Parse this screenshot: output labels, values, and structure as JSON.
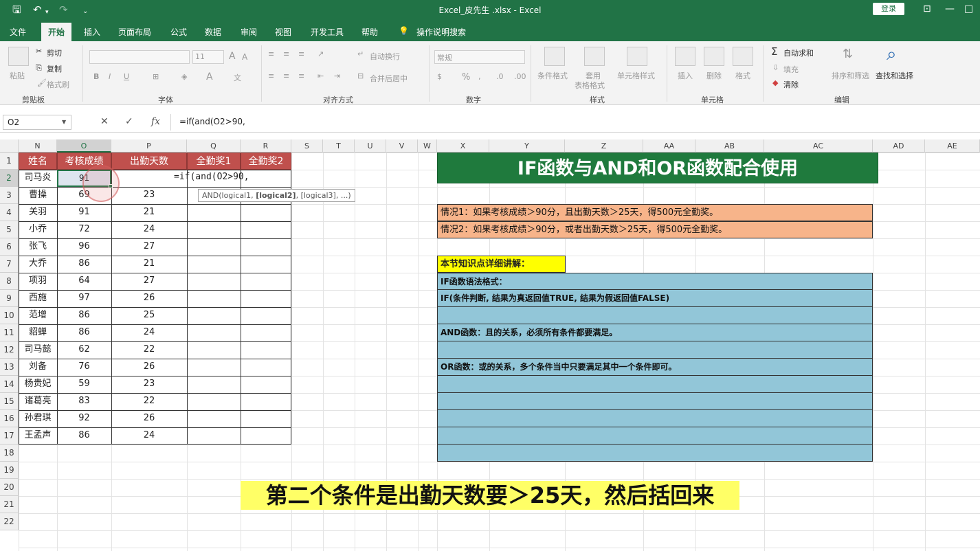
{
  "app": {
    "title": "Excel_皮先生 .xlsx  -  Excel",
    "login": "登录"
  },
  "menu": [
    "文件",
    "开始",
    "插入",
    "页面布局",
    "公式",
    "数据",
    "审阅",
    "视图",
    "开发工具",
    "帮助",
    "操作说明搜索"
  ],
  "ribbon": {
    "clipboard": {
      "paste": "粘贴",
      "cut": "剪切",
      "copy": "复制",
      "format_painter": "格式刷",
      "label": "剪贴板"
    },
    "font": {
      "size": "11",
      "label": "字体",
      "bold": "B",
      "italic": "I",
      "underline": "U"
    },
    "align": {
      "wrap": "自动换行",
      "merge": "合并后居中",
      "label": "对齐方式"
    },
    "number": {
      "format": "常规",
      "label": "数字"
    },
    "styles": {
      "cond": "条件格式",
      "table": "套用",
      "table2": "表格格式",
      "cell": "单元格样式",
      "label": "样式"
    },
    "cells": {
      "insert": "插入",
      "delete": "删除",
      "format": "格式",
      "label": "单元格"
    },
    "edit": {
      "autosum": "自动求和",
      "fill": "填充",
      "clear": "清除",
      "sort": "排序和筛选",
      "find": "查找和选择",
      "label": "编辑"
    }
  },
  "formula_bar": {
    "name_box": "O2",
    "cancel": "✕",
    "enter": "✓",
    "fx": "fx",
    "formula": "=if(and(O2>90,"
  },
  "columns": [
    "N",
    "O",
    "P",
    "Q",
    "R",
    "S",
    "T",
    "U",
    "V",
    "W",
    "X",
    "Y",
    "Z",
    "AA",
    "AB",
    "AC",
    "AD",
    "AE"
  ],
  "rows": [
    "1",
    "2",
    "3",
    "4",
    "5",
    "6",
    "7",
    "8",
    "9",
    "10",
    "11",
    "12",
    "13",
    "14",
    "15",
    "16",
    "17",
    "18",
    "19",
    "20",
    "21",
    "22"
  ],
  "table": {
    "headers": [
      "姓名",
      "考核成绩",
      "出勤天数",
      "全勤奖1",
      "全勤奖2"
    ],
    "names": [
      "司马炎",
      "曹操",
      "关羽",
      "小乔",
      "张飞",
      "大乔",
      "项羽",
      "西施",
      "范增",
      "貂蝉",
      "司马懿",
      "刘备",
      "杨贵妃",
      "诸葛亮",
      "孙君琪",
      "王孟声"
    ],
    "scores": [
      "91",
      "69",
      "91",
      "72",
      "96",
      "86",
      "64",
      "97",
      "86",
      "86",
      "62",
      "76",
      "59",
      "83",
      "92",
      "86"
    ],
    "days": [
      "",
      "23",
      "21",
      "24",
      "27",
      "21",
      "27",
      "26",
      "25",
      "24",
      "22",
      "26",
      "23",
      "22",
      "26",
      "24"
    ]
  },
  "editing": {
    "text": "=if(and(O2>90,",
    "tooltip_pre": "AND(logical1, ",
    "tooltip_bold": "[logical2]",
    "tooltip_post": ", [logical3], ...)"
  },
  "info": {
    "title": "IF函数与AND和OR函数配合使用",
    "case1": "情况1：如果考核成绩＞90分，且出勤天数＞25天，得500元全勤奖。",
    "case2": "情况2：如果考核成绩＞90分，或者出勤天数＞25天，得500元全勤奖。",
    "kp_title": "本节知识点详细讲解：",
    "kp_lines": [
      "IF函数语法格式：",
      "IF(条件判断, 结果为真返回值TRUE, 结果为假返回值FALSE)",
      "",
      "AND函数：且的关系，必须所有条件都要满足。",
      "",
      "OR函数：或的关系，多个条件当中只要满足其中一个条件即可。",
      "",
      "",
      "",
      "",
      ""
    ]
  },
  "subtitle": "第二个条件是出勤天数要＞25天，然后括回来",
  "colors": {
    "excel_green": "#217346",
    "header_red": "#c0504d",
    "banner_green": "#1f7a3d",
    "case_orange": "#f7b48a",
    "kp_blue": "#92c6d8",
    "highlight_yellow": "#ffff00"
  }
}
